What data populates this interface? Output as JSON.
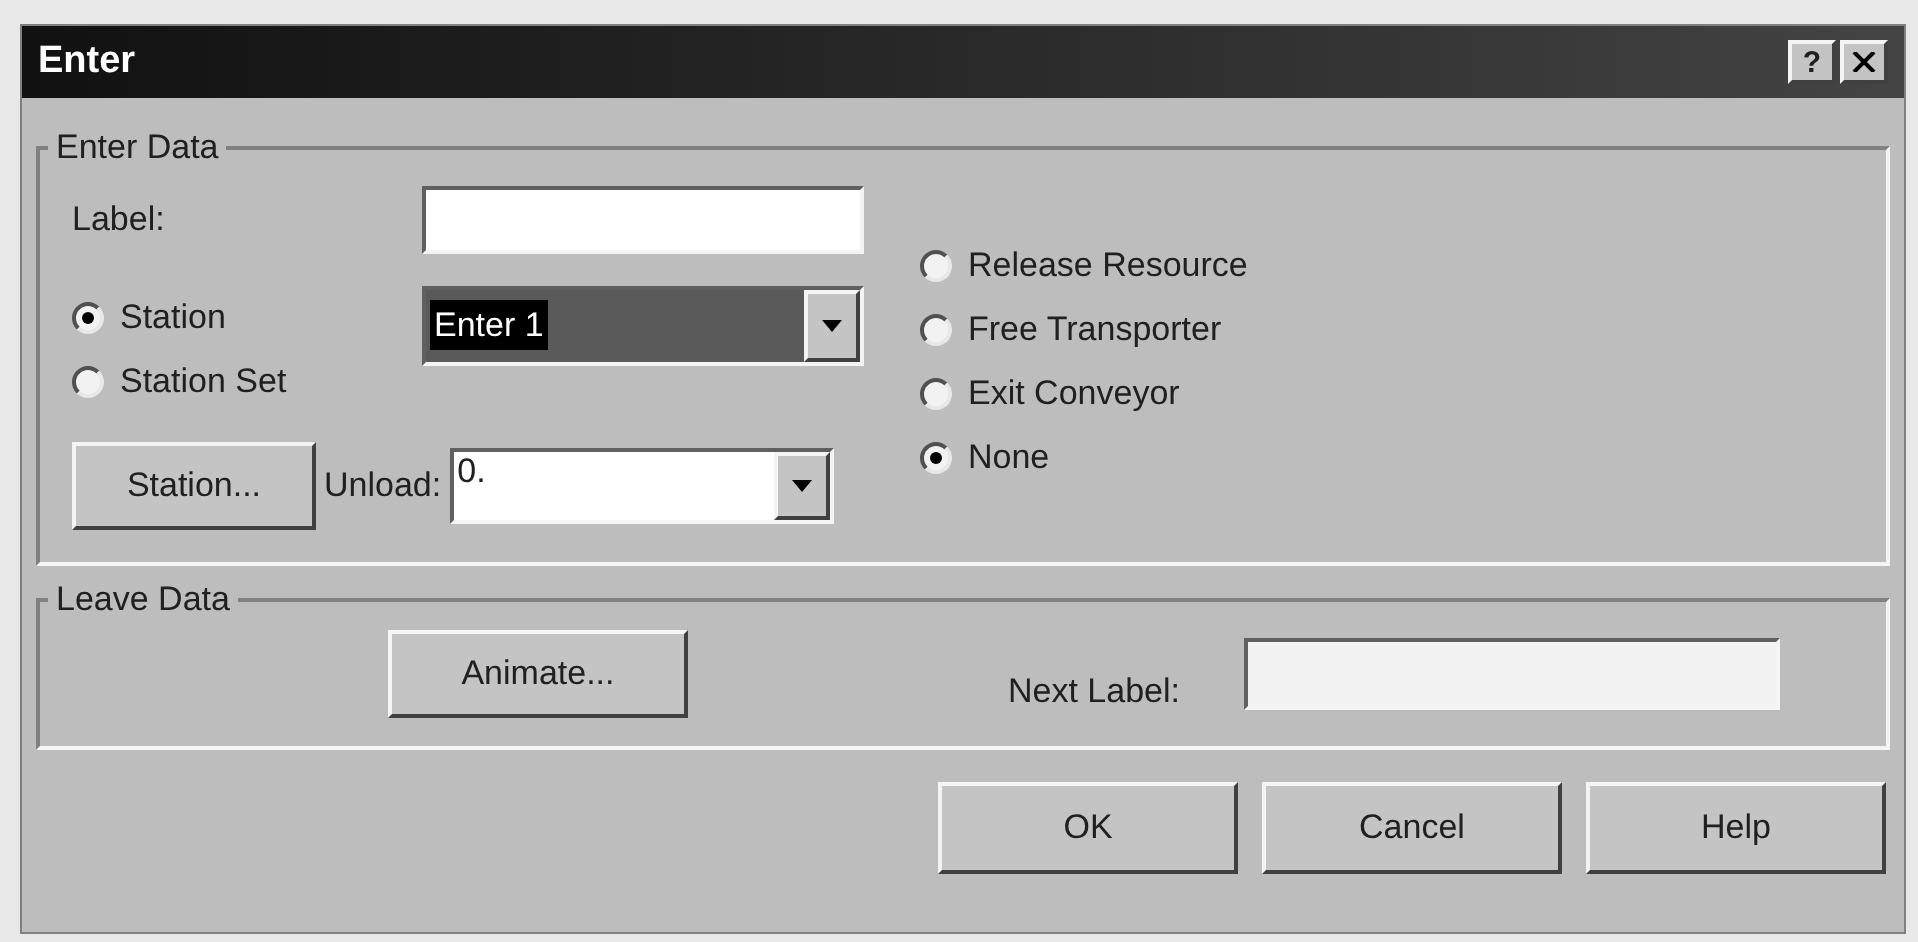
{
  "window": {
    "title": "Enter",
    "help_button": "?"
  },
  "enter_data": {
    "title": "Enter Data",
    "label": {
      "text": "Label:"
    },
    "station_type": [
      {
        "label": "Station",
        "selected": true
      },
      {
        "label": "Station Set",
        "selected": false
      }
    ],
    "station_combo": {
      "value": "Enter 1"
    },
    "station_button": "Station...",
    "unload": {
      "text": "Unload:",
      "value": "0."
    },
    "exit_options": [
      {
        "label": "Release Resource",
        "selected": false
      },
      {
        "label": "Free Transporter",
        "selected": false
      },
      {
        "label": "Exit Conveyor",
        "selected": false
      },
      {
        "label": "None",
        "selected": true
      }
    ]
  },
  "leave_data": {
    "title": "Leave Data",
    "animate_button": "Animate...",
    "next_label": {
      "text": "Next Label:"
    }
  },
  "buttons": [
    "OK",
    "Cancel",
    "Help"
  ]
}
